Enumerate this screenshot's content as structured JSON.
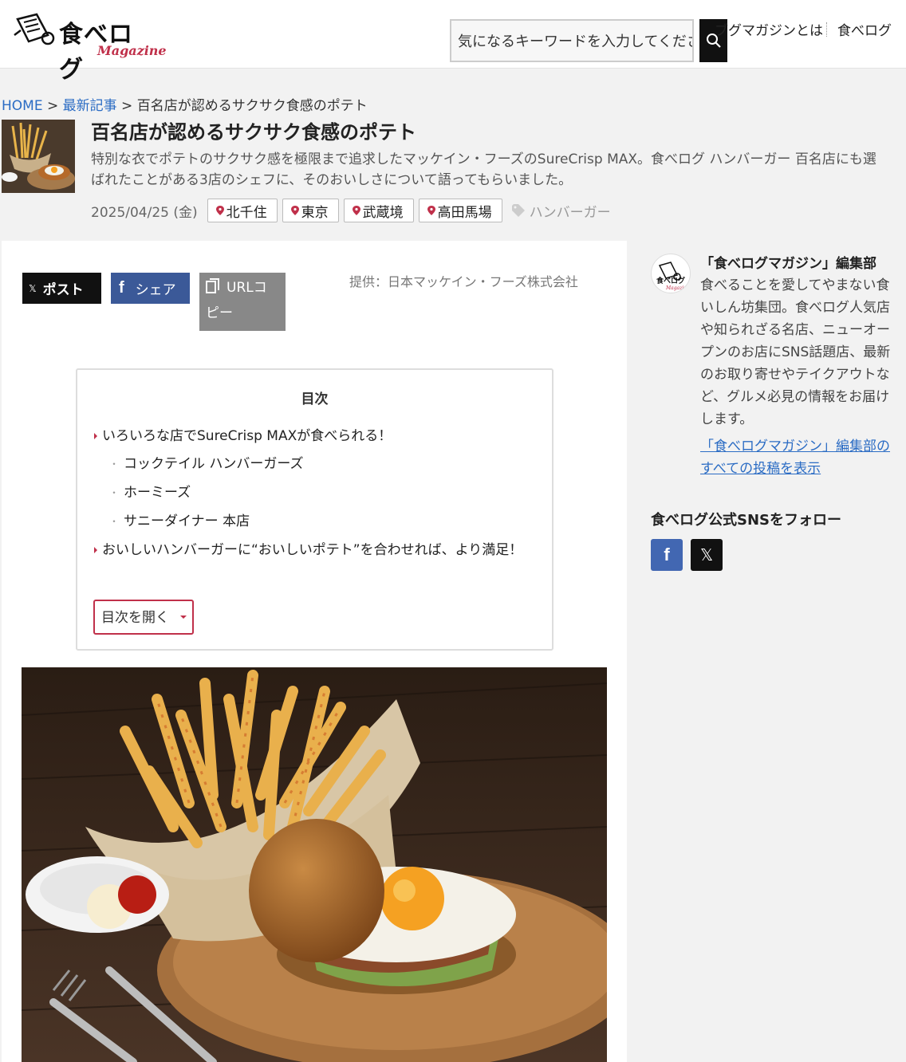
{
  "header": {
    "logo_text": "食べログ",
    "logo_sub": "Magazine",
    "search_placeholder": "気になるキーワードを入力してください",
    "nav_about": "ブグマガジンとは",
    "nav_tabelog": "食べログ"
  },
  "breadcrumb": {
    "home": "HOME",
    "sep1": ">",
    "latest": "最新記事",
    "sep2": ">",
    "current": "百名店が認めるサクサク食感のポテト"
  },
  "article": {
    "title": "百名店が認めるサクサク食感のポテト",
    "lead": "特別な衣でポテトのサクサク感を極限まで追求したマッケイン・フーズのSureCrisp MAX。食べログ ハンバーガー 百名店にも選ばれたことがある3店のシェフに、そのおいしさについて語ってもらいました。",
    "date": "2025/04/25 (金)",
    "tags": [
      "北千住",
      "東京",
      "武蔵境",
      "高田馬場"
    ],
    "category": "ハンバーガー",
    "provider": "提供：日本マッケイン・フーズ株式会社"
  },
  "share": {
    "x_label": "ポスト",
    "fb_label": "シェア",
    "url_label": "URLコピー"
  },
  "toc": {
    "title": "目次",
    "items": [
      "いろいろな店でSureCrisp MAXが食べられる！",
      "コックテイル ハンバーガーズ",
      "ホーミーズ",
      "サニーダイナー 本店",
      "おいしいハンバーガーに“おいしいポテト”を合わせれば、より満足！"
    ],
    "open_button": "目次を開く"
  },
  "sidebar": {
    "author_name": "「食べログマガジン」編集部",
    "author_desc": "食べることを愛してやまない食いしん坊集団。食べログ人気店や知られざる名店、ニューオープンのお店にSNS話題店、最新のお取り寄せやテイクアウトなど、グルメ必見の情報をお届けします。",
    "author_link": "「食べログマガジン」編集部のすべての投稿を表示",
    "sns_title": "食べログ公式SNSをフォロー"
  },
  "colors": {
    "accent": "#c0304a",
    "link": "#2b6cc4",
    "facebook": "#3b5998",
    "x": "#111111"
  }
}
